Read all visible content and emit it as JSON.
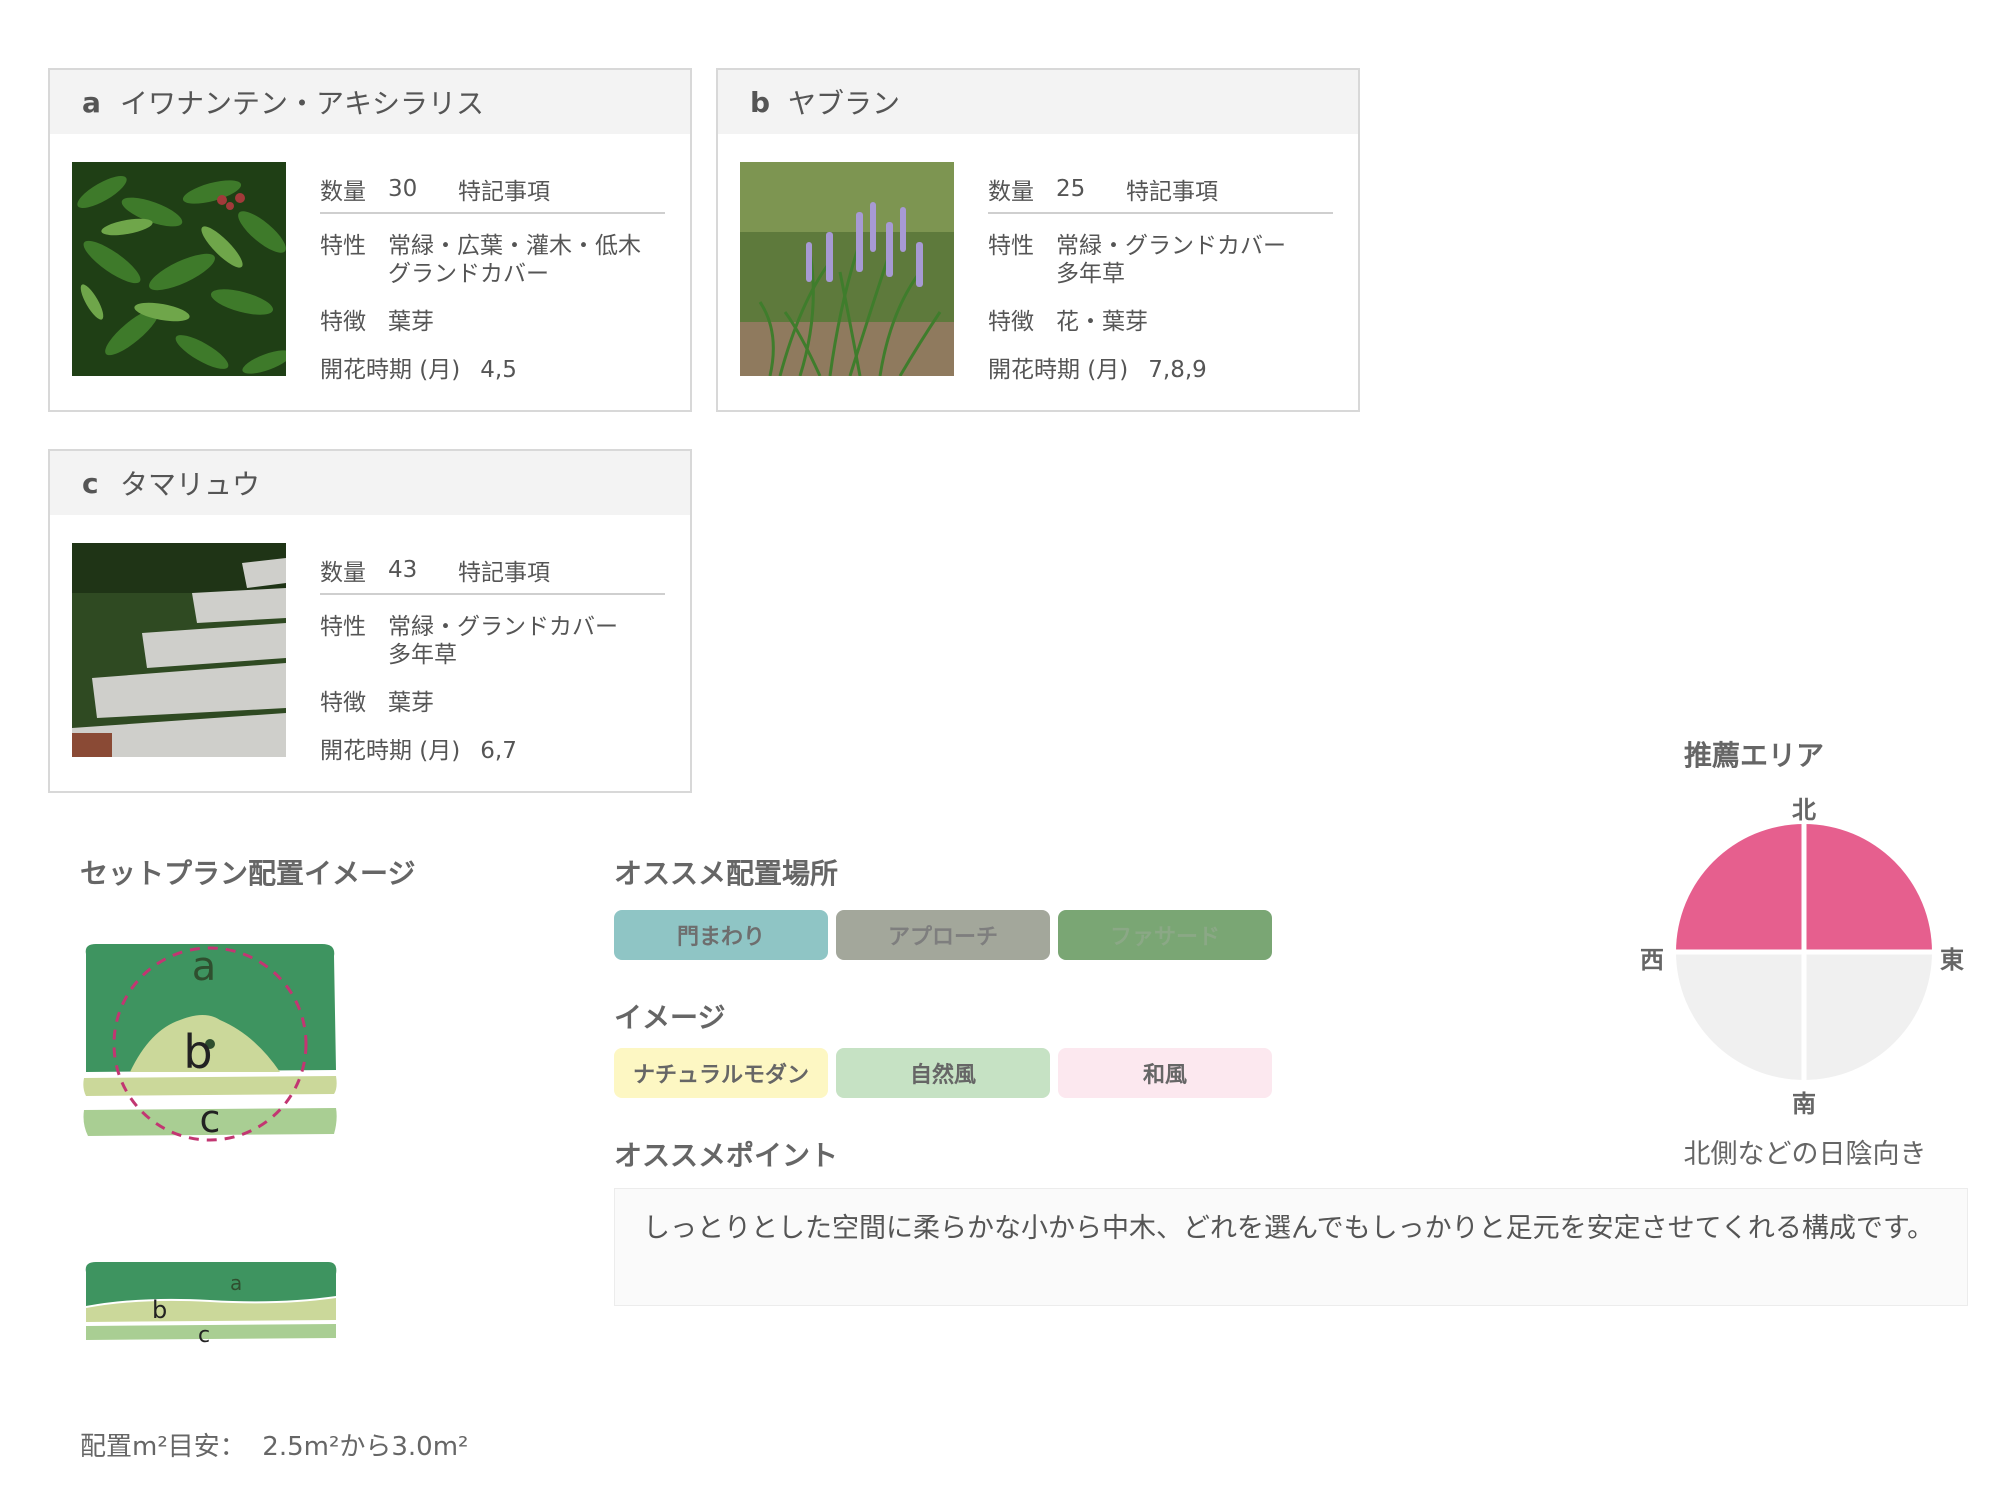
{
  "cards": [
    {
      "letter": "a",
      "name": "イワナンテン・アキシラリス",
      "qty_label": "数量",
      "qty": "30",
      "note_label": "特記事項",
      "trait_label": "特性",
      "trait_line1": "常緑・広葉・灌木・低木",
      "trait_line2": "グランドカバー",
      "feature_label": "特徴",
      "feature": "葉芽",
      "bloom_label": "開花時期 (月)",
      "bloom": "4,5",
      "photo_icon": "leafy-shrub-photo"
    },
    {
      "letter": "b",
      "name": "ヤブラン",
      "qty_label": "数量",
      "qty": "25",
      "note_label": "特記事項",
      "trait_label": "特性",
      "trait_line1": "常緑・グランドカバー",
      "trait_line2": "多年草",
      "feature_label": "特徴",
      "feature": "花・葉芽",
      "bloom_label": "開花時期 (月)",
      "bloom": "7,8,9",
      "photo_icon": "liriope-flower-photo"
    },
    {
      "letter": "c",
      "name": "タマリュウ",
      "qty_label": "数量",
      "qty": "43",
      "note_label": "特記事項",
      "trait_label": "特性",
      "trait_line1": "常緑・グランドカバー",
      "trait_line2": "多年草",
      "feature_label": "特徴",
      "feature": "葉芽",
      "bloom_label": "開花時期 (月)",
      "bloom": "6,7",
      "photo_icon": "stepping-stone-groundcover-photo"
    }
  ],
  "setplan": {
    "title": "セットプラン配置イメージ",
    "top_labels": [
      "a",
      "b",
      "c"
    ],
    "side_labels": [
      "a",
      "b",
      "c"
    ],
    "area_note": "配置m²目安：  2.5m²から3.0m²"
  },
  "placement": {
    "title": "オススメ配置場所",
    "tags": [
      {
        "label": "門まわり",
        "bg": "#8fc5c5",
        "fg": "#6e6e6e"
      },
      {
        "label": "アプローチ",
        "bg": "#a3a79b",
        "fg": "#7e7e7e"
      },
      {
        "label": "ファサード",
        "bg": "#7aa674",
        "fg": "#8ba886"
      }
    ]
  },
  "image": {
    "title": "イメージ",
    "tags": [
      {
        "label": "ナチュラルモダン",
        "bg": "#fdf7c3",
        "fg": "#666"
      },
      {
        "label": "自然風",
        "bg": "#c6e2c4",
        "fg": "#666"
      },
      {
        "label": "和風",
        "bg": "#fce8ef",
        "fg": "#666"
      }
    ]
  },
  "point": {
    "title": "オススメポイント",
    "text": "しっとりとした空間に柔らかな小から中木、どれを選んでもしっかりと足元を安定させてくれる構成です。"
  },
  "area": {
    "title": "推薦エリア",
    "north": "北",
    "south": "南",
    "east": "東",
    "west": "西",
    "note": "北側などの日陰向き",
    "highlight_color": "#e65f8e",
    "base_color": "#f0f0f0"
  }
}
